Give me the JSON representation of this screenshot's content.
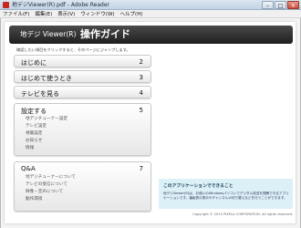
{
  "window": {
    "title": "地デジViewer(R).pdf - Adobe Reader",
    "minimize_symbol": "–",
    "maximize_symbol": "□",
    "close_symbol": "✕"
  },
  "menu": {
    "items": [
      "ファイル(F)",
      "編集(E)",
      "表示(V)",
      "ウィンドウ(W)",
      "ヘルプ(H)"
    ]
  },
  "document": {
    "header": {
      "product": "地デジ Viewer(R)",
      "title": "操作ガイド"
    },
    "instruction": "確認したい項目をクリックすると、そのページにジャンプします。",
    "toc": [
      {
        "label": "はじめに",
        "page": "2",
        "subs": []
      },
      {
        "label": "はじめて使うとき",
        "page": "3",
        "subs": []
      },
      {
        "label": "テレビを見る",
        "page": "4",
        "subs": []
      },
      {
        "label": "設定する",
        "page": "5",
        "subs": [
          "地デジチューナー設定",
          "テレビ設定",
          "視聴設定",
          "お知らせ",
          "情報"
        ]
      },
      {
        "label": "Q&A",
        "page": "7",
        "subs": [
          "地デジチューナーについて",
          "テレビの受信について",
          "映像・音声について",
          "動作環境"
        ]
      }
    ],
    "info_box": {
      "title": "このアプリケーションでできること",
      "body": "地デジViewer(R)は、お使いのWindowsパソコンでデジタル放送を視聴できるアプリケーションです。番組表の表示やチャンネルの切り替えなどを行うことができます。"
    },
    "copyright": "Copyright © 2013  PIXELA CORPORATION. All rights reserved."
  },
  "colors": {
    "header_bg": "#2a2a2a",
    "info_bg": "#dcf0f8",
    "titlebar": "#c3d3e4"
  }
}
